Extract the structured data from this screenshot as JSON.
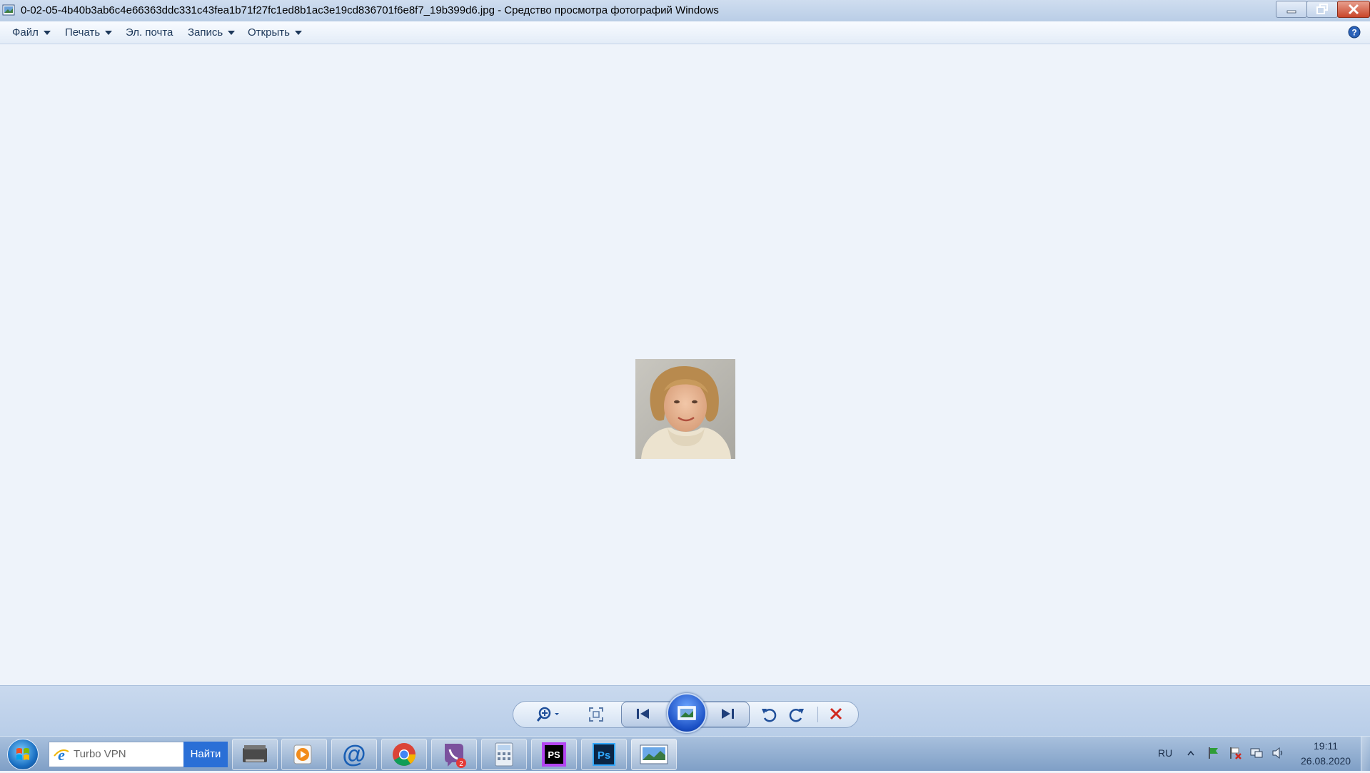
{
  "window": {
    "title": "0-02-05-4b40b3ab6c4e66363ddc331c43fea1b71f27fc1ed8b1ac3e19cd836701f6e8f7_19b399d6.jpg - Средство просмотра фотографий Windows"
  },
  "menu": {
    "items": [
      {
        "label": "Файл",
        "has_arrow": true
      },
      {
        "label": "Печать",
        "has_arrow": true
      },
      {
        "label": "Эл. почта",
        "has_arrow": false
      },
      {
        "label": "Запись",
        "has_arrow": true
      },
      {
        "label": "Открыть",
        "has_arrow": true
      }
    ]
  },
  "controls": {
    "icons": [
      "zoom-icon",
      "actual-size-icon",
      "previous-icon",
      "slideshow-icon",
      "next-icon",
      "rotate-left-icon",
      "rotate-right-icon",
      "delete-icon"
    ]
  },
  "taskbar": {
    "search_value": "Turbo VPN",
    "search_button": "Найти",
    "apps": [
      "scanner-app",
      "media-player-app",
      "mail-app",
      "chrome-app",
      "viber-app",
      "calculator-app",
      "phpstorm-app",
      "photoshop-app",
      "photo-viewer-app"
    ],
    "viber_badge": "2",
    "phpstorm_label": "PS",
    "photoshop_label": "Ps",
    "language": "RU",
    "time": "19:11",
    "date": "26.08.2020"
  },
  "colors": {
    "viewer_bg": "#eef3fa",
    "accent": "#2a6fd6",
    "delete_red": "#d0281e"
  }
}
